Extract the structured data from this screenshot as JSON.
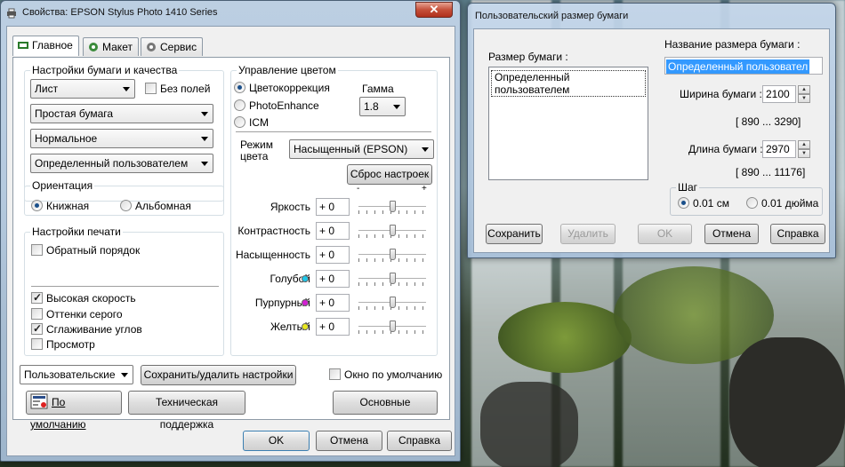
{
  "main_dialog": {
    "title": "Свойства: EPSON Stylus Photo 1410 Series",
    "tabs": [
      {
        "label": "Главное"
      },
      {
        "label": "Макет"
      },
      {
        "label": "Сервис"
      }
    ],
    "paper_quality": {
      "group_label": "Настройки бумаги и качества",
      "paper_size": "Лист",
      "borderless_label": "Без полей",
      "borderless_checked": false,
      "media_type": "Простая бумага",
      "quality": "Нормальное",
      "custom_size": "Определенный пользователем"
    },
    "orientation": {
      "group_label": "Ориентация",
      "portrait": "Книжная",
      "landscape": "Альбомная",
      "selected": "portrait"
    },
    "print_settings": {
      "group_label": "Настройки печати",
      "reverse_order": {
        "label": "Обратный порядок",
        "checked": false
      },
      "high_speed": {
        "label": "Высокая скорость",
        "checked": true
      },
      "grayscale": {
        "label": "Оттенки серого",
        "checked": false
      },
      "smoothing": {
        "label": "Сглаживание углов",
        "checked": true
      },
      "preview": {
        "label": "Просмотр",
        "checked": false
      }
    },
    "color_management": {
      "group_label": "Управление цветом",
      "color_correction": "Цветокоррекция",
      "photo_enhance": "PhotoEnhance",
      "icm": "ICM",
      "selected": "color_correction",
      "gamma_label": "Гамма",
      "gamma_value": "1.8",
      "color_mode_label": "Режим цвета",
      "color_mode_value": "Насыщенный (EPSON)",
      "reset_button": "Сброс настроек",
      "scale_minus": "-",
      "scale_plus": "+",
      "sliders": [
        {
          "label": "Яркость",
          "value": "+ 0",
          "level": 0.5,
          "color": ""
        },
        {
          "label": "Контрастность",
          "value": "+ 0",
          "level": 0.5,
          "color": ""
        },
        {
          "label": "Насыщенность",
          "value": "+ 0",
          "level": 0.5,
          "color": ""
        },
        {
          "label": "Голубой",
          "value": "+ 0",
          "level": 0.5,
          "color": "#1fc6e8"
        },
        {
          "label": "Пурпурный",
          "value": "+ 0",
          "level": 0.5,
          "color": "#d21fd2"
        },
        {
          "label": "Желтый",
          "value": "+ 0",
          "level": 0.5,
          "color": "#e8e81f"
        }
      ]
    },
    "custom_settings_value": "Пользовательские",
    "save_delete_button": "Сохранить/удалить настройки",
    "default_window_label": "Окно по умолчанию",
    "default_window_checked": false,
    "defaults_button": "По умолчанию",
    "tech_support_button": "Техническая поддержка",
    "basic_button": "Основные",
    "ok_button": "OK",
    "cancel_button": "Отмена",
    "help_button": "Справка"
  },
  "custom_paper_dialog": {
    "title": "Пользовательский размер бумаги",
    "paper_size_label": "Размер бумаги :",
    "list_items": [
      "Определенный пользователем"
    ],
    "paper_name_label": "Название размера бумаги :",
    "paper_name_value": "Определенный пользовател",
    "width_label": "Ширина бумаги :",
    "width_value": "2100",
    "width_range": "[ 890 ... 3290]",
    "length_label": "Длина бумаги :",
    "length_value": "2970",
    "length_range": "[ 890 ... 11176]",
    "step_label": "Шаг",
    "step_cm": "0.01 см",
    "step_inch": "0.01 дюйма",
    "step_selected": "cm",
    "save_button": "Сохранить",
    "delete_button": "Удалить",
    "ok_button": "OK",
    "cancel_button": "Отмена",
    "help_button": "Справка"
  }
}
